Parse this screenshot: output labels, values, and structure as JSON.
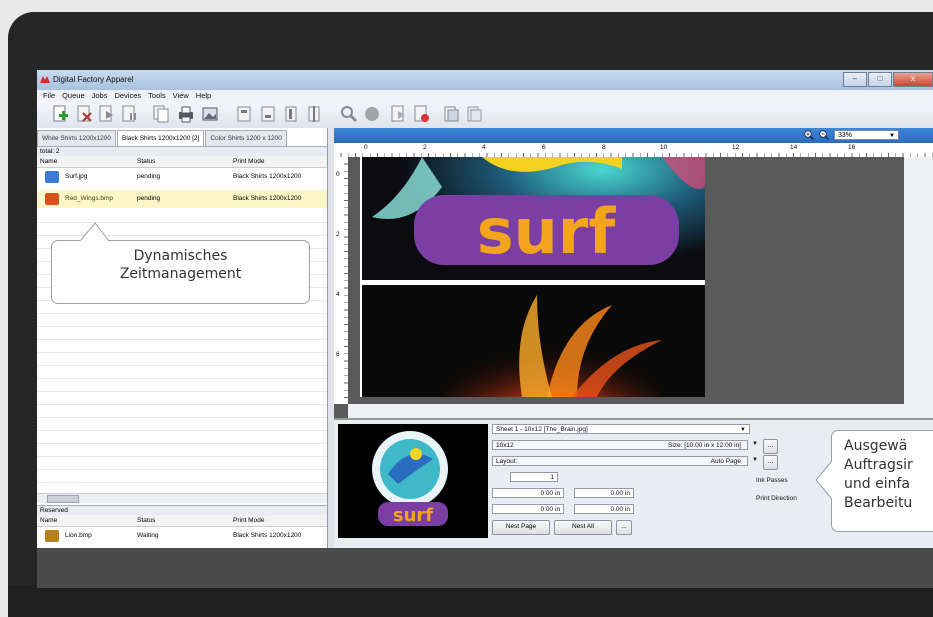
{
  "window": {
    "title": "Digital Factory Apparel",
    "controls": [
      "–",
      "□",
      "x"
    ]
  },
  "menu": [
    "File",
    "Queue",
    "Jobs",
    "Devices",
    "Tools",
    "View",
    "Help"
  ],
  "tabs": [
    {
      "label": "White Shirts 1200x1200",
      "active": false
    },
    {
      "label": "Black Shirts 1200x1200 [2]",
      "active": true
    },
    {
      "label": "Color Shirts 1200 x 1200",
      "active": false
    }
  ],
  "queue": {
    "total_label": "total: 2",
    "columns": [
      "Name",
      "Status",
      "Print Mode"
    ],
    "rows": [
      {
        "name": "Surf.jpg",
        "status": "pending",
        "mode": "Black Shirts 1200x1200",
        "thumb_color": "#3a7bd5"
      },
      {
        "name": "Red_Wings.bmp",
        "status": "pending",
        "mode": "Black Shirts 1200x1200",
        "thumb_color": "#d4501c"
      }
    ]
  },
  "reserved": {
    "label": "Reserved",
    "columns": [
      "Name",
      "Status",
      "Print Mode"
    ],
    "rows": [
      {
        "name": "Lion.bmp",
        "status": "Waiting",
        "mode": "Black Shirts 1200x1200",
        "thumb_color": "#b8801c"
      }
    ]
  },
  "zoom": {
    "value": "33%"
  },
  "ruler": {
    "top": [
      "0",
      "2",
      "4",
      "6",
      "8",
      "10",
      "12",
      "14",
      "16"
    ],
    "left": [
      "0",
      "2",
      "4",
      "6"
    ]
  },
  "canvas": {
    "word": "surf"
  },
  "sheet": {
    "select": "Sheet 1 - 10x12  [The_Brain.jpg]",
    "size_field": "10x12",
    "size_label": "Size: [10.00 in x 12.00 in]",
    "layout_label": "Layout:",
    "layout_value": "Auto Page",
    "copies": "1",
    "margin_1": "0.00 in",
    "margin_2": "0.00 in",
    "margin_3": "0.00 in",
    "margin_4": "0.00 in",
    "ink_passes": "Ink Passes",
    "print_direction": "Print Direction",
    "nest_page": "Nest Page",
    "nest_all": "Nest All",
    "more": "...",
    "more_2": "..."
  },
  "callouts": {
    "left": [
      "Dynamisches",
      "Zeitmanagement"
    ],
    "right": [
      "Ausgewä",
      "Auftragsir",
      "und einfa",
      "Bearbeitu"
    ]
  },
  "colors": {
    "accent": "#2a6cc0",
    "selection": "#fdf6c8",
    "purple": "#7b3fa4",
    "orange": "#f2a51c"
  }
}
